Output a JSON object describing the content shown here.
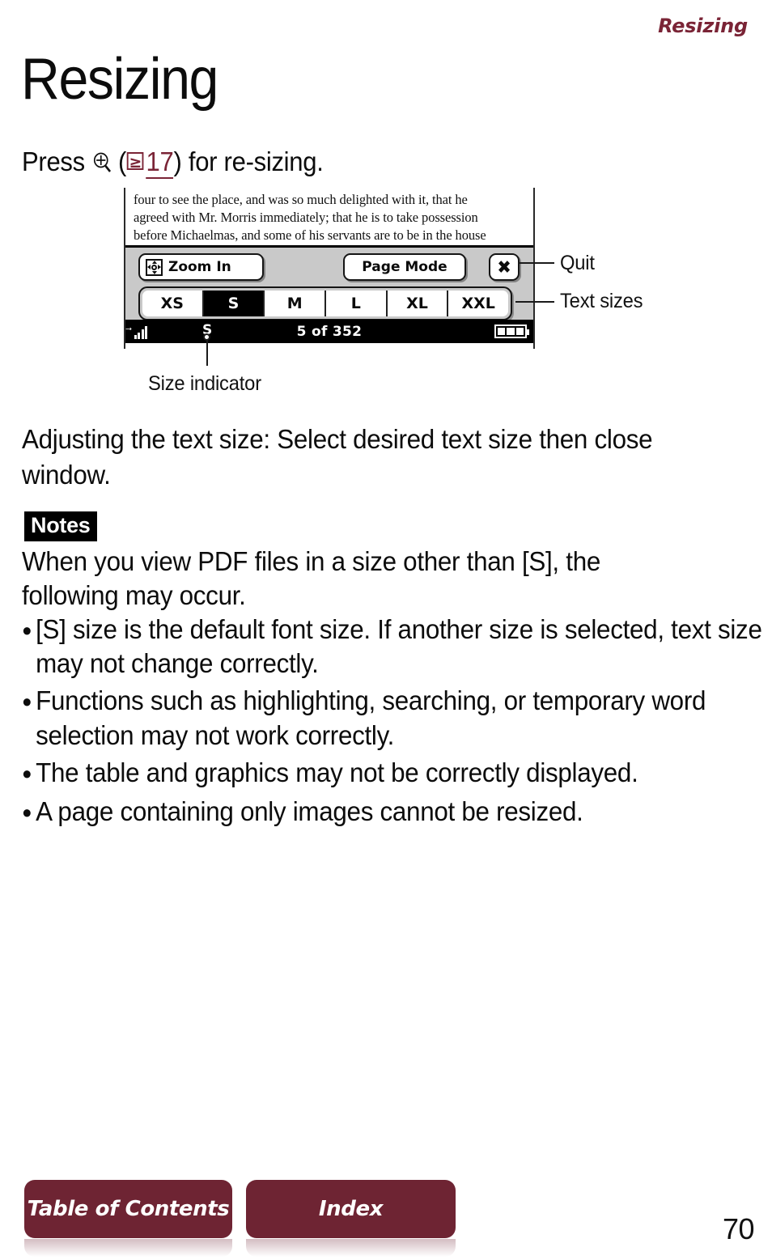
{
  "header": {
    "running_title": "Resizing",
    "accent_color": "#7a2436"
  },
  "page_title": "Resizing",
  "intro": {
    "prefix": "Press",
    "key_icon": "magnifier-plus-icon",
    "open_paren": "(",
    "xref_icon": "≥",
    "xref_page": "17",
    "close_paren": ")",
    "suffix": "for re-sizing."
  },
  "device_screenshot": {
    "ebook_lines": [
      "four to see the place, and was so much delighted with it, that he",
      "agreed with Mr. Morris immediately; that he is to take possession",
      "before Michaelmas, and some of his servants are to be in the house"
    ],
    "toolbar": {
      "zoom_in_label": "Zoom In",
      "zoom_in_icon": "four-way-navigation-icon",
      "page_mode_label": "Page Mode",
      "quit_icon": "close-x-icon"
    },
    "text_sizes": {
      "options": [
        "XS",
        "S",
        "M",
        "L",
        "XL",
        "XXL"
      ],
      "selected": "S"
    },
    "status_bar": {
      "signal_icon": "signal-strength-icon",
      "size_indicator": "S",
      "page_count": "5 of 352",
      "battery_icon": "battery-icon",
      "battery_segments": 3
    }
  },
  "callouts": {
    "quit": "Quit",
    "text_sizes": "Text sizes",
    "size_indicator": "Size indicator"
  },
  "body": {
    "adjusting_paragraph": "Adjusting the text size: Select desired text size then close window."
  },
  "notes": {
    "badge": "Notes",
    "intro": "When you view PDF files in a size other than [S], the following may occur.",
    "bullets": [
      "[S] size is the default font size. If another size is selected, text size may not change correctly.",
      "Functions such as highlighting, searching, or temporary word selection may not work correctly.",
      "The table and graphics may not be correctly displayed.",
      "A page containing only images cannot be resized."
    ],
    "bullet_glyph": "●"
  },
  "footer": {
    "table_of_contents_label": "Table of Contents",
    "index_label": "Index",
    "page_number": "70",
    "button_color": "#6e2433"
  }
}
